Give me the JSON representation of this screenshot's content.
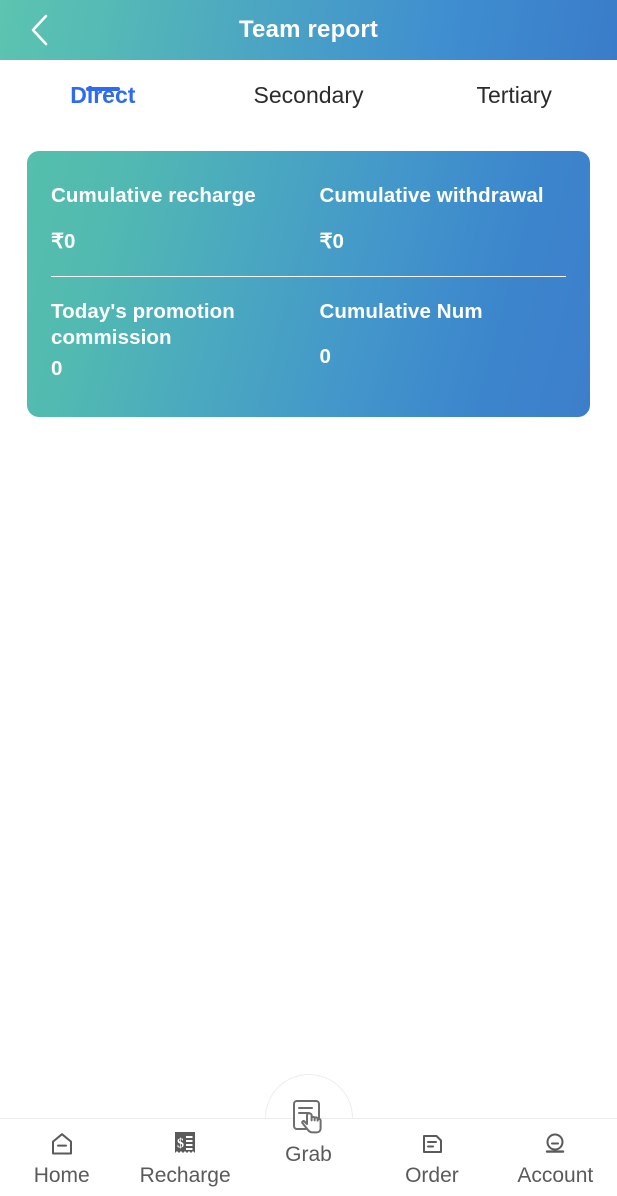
{
  "header": {
    "title": "Team report",
    "back_icon": "chevron-left-icon",
    "gradient_start": "#5cc4b0",
    "gradient_end": "#3a7cc9"
  },
  "tabs": {
    "active_index": 0,
    "active_color": "#2f6bf2",
    "items": [
      {
        "label": "Direct"
      },
      {
        "label": "Secondary"
      },
      {
        "label": "Tertiary"
      }
    ]
  },
  "card": {
    "gradient_start": "#55bfac",
    "gradient_end": "#3d7ecb",
    "stats": [
      {
        "title": "Cumulative recharge",
        "value": "₹0"
      },
      {
        "title": "Cumulative withdrawal",
        "value": "₹0"
      },
      {
        "title": "Today's promotion commission",
        "value": "0"
      },
      {
        "title": "Cumulative Num",
        "value": "0"
      }
    ]
  },
  "bottom_nav": {
    "active_index": 2,
    "items": [
      {
        "label": "Home",
        "icon": "home-icon"
      },
      {
        "label": "Recharge",
        "icon": "receipt-dollar-icon"
      },
      {
        "label": "Grab",
        "icon": "document-hand-tap-icon"
      },
      {
        "label": "Order",
        "icon": "document-lines-icon"
      },
      {
        "label": "Account",
        "icon": "person-icon"
      }
    ]
  }
}
